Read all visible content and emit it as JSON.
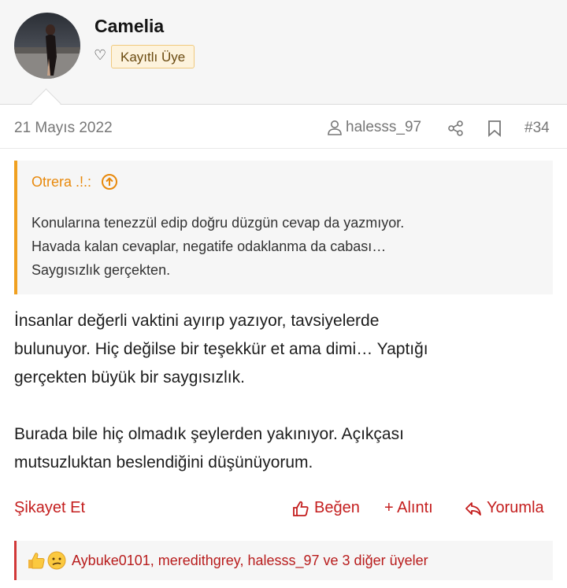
{
  "post": {
    "username": "Camelia",
    "user_badge": "Kayıtlı Üye",
    "date": "21 Mayıs 2022",
    "author": "halesss_97",
    "post_number": "#34"
  },
  "quote": {
    "author": "Otrera .!.:",
    "lines": [
      "Konularına tenezzül edip doğru düzgün cevap da yazmıyor.",
      "Havada kalan cevaplar, negatife odaklanma da cabası…",
      "Saygısızlık gerçekten."
    ]
  },
  "message": {
    "paragraphs": [
      [
        "İnsanlar değerli vaktini ayırıp yazıyor, tavsiyelerde",
        "bulunuyor. Hiç değilse bir teşekkür et ama dimi… Yaptığı",
        "gerçekten büyük bir saygısızlık."
      ],
      [
        "Burada bile hiç olmadık şeylerden yakınıyor. Açıkçası",
        "mutsuzluktan beslendiğini düşünüyorum."
      ]
    ]
  },
  "actions": {
    "report": "Şikayet Et",
    "like": "Beğen",
    "quote": "+ Alıntı",
    "reply": "Yorumla"
  },
  "reactions": {
    "text": "Aybuke0101, meredithgrey, halesss_97 ve 3 diğer üyeler"
  },
  "icons": {
    "heart": "heart-icon",
    "user": "user-icon",
    "share": "share-icon",
    "bookmark": "bookmark-icon",
    "quote_link": "arrow-up-circle-icon",
    "like": "thumbs-up-icon",
    "reply": "reply-icon",
    "reaction_like": "thumbs-up-emoji",
    "reaction_confused": "confused-emoji"
  },
  "colors": {
    "accent_orange": "#f0a020",
    "action_red": "#c41e1e",
    "badge_bg": "#fdf3dd"
  }
}
